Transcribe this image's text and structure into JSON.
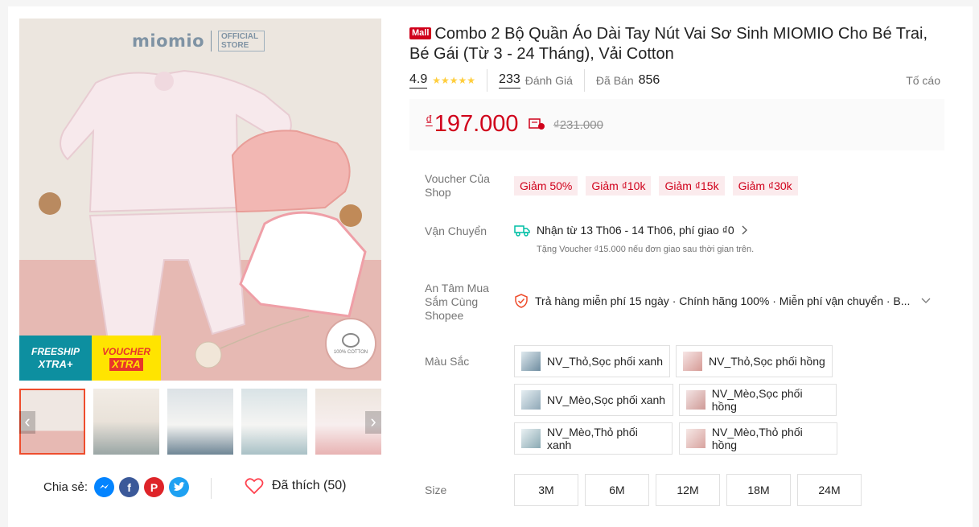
{
  "gallery": {
    "brand_name": "miomio",
    "brand_store": "OFFICIAL STORE",
    "freeship_label": "FREESHIP",
    "freeship_sub": "XTRA+",
    "voucher_label": "VOUCHER",
    "voucher_sub": "XTRA",
    "cotton_label": "100% COTTON",
    "prev_arrow": "‹",
    "next_arrow": "›"
  },
  "share": {
    "label": "Chia sẻ:",
    "icons": [
      "messenger-icon",
      "facebook-icon",
      "pinterest-icon",
      "twitter-icon"
    ]
  },
  "like": {
    "label": "Đã thích (50)"
  },
  "product": {
    "mall_badge": "Mall",
    "title": "Combo 2 Bộ Quần Áo Dài Tay Nút Vai Sơ Sinh MIOMIO Cho Bé Trai, Bé Gái (Từ 3 - 24 Tháng), Vải Cotton",
    "rating": "4.9",
    "stars": "★★★★★",
    "review_count": "233",
    "review_label": "Đánh Giá",
    "sold_label": "Đã Bán",
    "sold_count": "856",
    "report_label": "Tố cáo"
  },
  "price": {
    "currency": "₫",
    "current": "197.000",
    "original": "₫231.000"
  },
  "voucher": {
    "label": "Voucher Của Shop",
    "chips": [
      "Giảm 50%",
      "Giảm ₫10k",
      "Giảm ₫15k",
      "Giảm ₫30k"
    ]
  },
  "shipping": {
    "label": "Vận Chuyển",
    "line": "Nhận từ 13 Th06 - 14 Th06, phí giao ₫0",
    "sub": "Tặng Voucher ₫15.000 nếu đơn giao sau thời gian trên."
  },
  "guarantee": {
    "label": "An Tâm Mua Sắm Cùng Shopee",
    "text": "Trả hàng miễn phí 15 ngày · Chính hãng 100% · Miễn phí vận chuyển · B..."
  },
  "color": {
    "label": "Màu Sắc",
    "options": [
      "NV_Thỏ,Sọc phối xanh",
      "NV_Thỏ,Sọc phối hồng",
      "NV_Mèo,Sọc phối xanh",
      "NV_Mèo,Sọc phối hồng",
      "NV_Mèo,Thỏ phối xanh",
      "NV_Mèo,Thỏ phối hồng"
    ]
  },
  "size": {
    "label": "Size",
    "options": [
      "3M",
      "6M",
      "12M",
      "18M",
      "24M"
    ]
  },
  "colors": {
    "accent": "#ee4d2d",
    "price": "#d0011b",
    "star": "#ffce3d"
  }
}
